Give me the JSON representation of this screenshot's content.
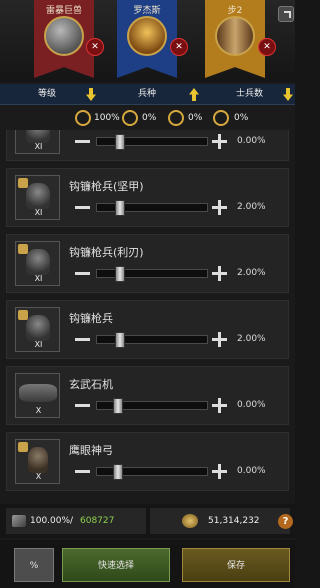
{
  "banners": [
    {
      "title": "雷暴巨兽",
      "color": "#7a1f22"
    },
    {
      "title": "罗杰斯",
      "color": "#1e3f86"
    },
    {
      "title": "步2",
      "color": "#b37c1c"
    }
  ],
  "remove_symbol": "✕",
  "tabs": {
    "level": "等级",
    "type": "兵种",
    "count": "士兵数"
  },
  "bonuses": [
    {
      "icon": "shield-icon",
      "value": "100%"
    },
    {
      "icon": "horse-icon",
      "value": "0%"
    },
    {
      "icon": "crossed-weapons-icon",
      "value": "0%"
    },
    {
      "icon": "bow-icon",
      "value": "0%"
    }
  ],
  "units": [
    {
      "name": "",
      "tier": "XI",
      "percent": "0.00%",
      "slider": 0.02
    },
    {
      "name": "钩镰枪兵(坚甲)",
      "tier": "XI",
      "percent": "2.00%",
      "slider": 0.02
    },
    {
      "name": "钩镰枪兵(利刃)",
      "tier": "XI",
      "percent": "2.00%",
      "slider": 0.02
    },
    {
      "name": "钩镰枪兵",
      "tier": "XI",
      "percent": "2.00%",
      "slider": 0.02
    },
    {
      "name": "玄武石机",
      "tier": "X",
      "percent": "0.00%",
      "slider": 0.0
    },
    {
      "name": "鹰眼神弓",
      "tier": "X",
      "percent": "0.00%",
      "slider": 0.0
    }
  ],
  "status": {
    "troop_ratio": "100.00%/",
    "troop_count": "608727",
    "resources": "51,314,232",
    "help": "?"
  },
  "buttons": {
    "percent": "%",
    "quick_select": "快速选择",
    "save": "保存"
  },
  "colors": {
    "accent": "#e8c431",
    "count_green": "#8fd14f"
  }
}
